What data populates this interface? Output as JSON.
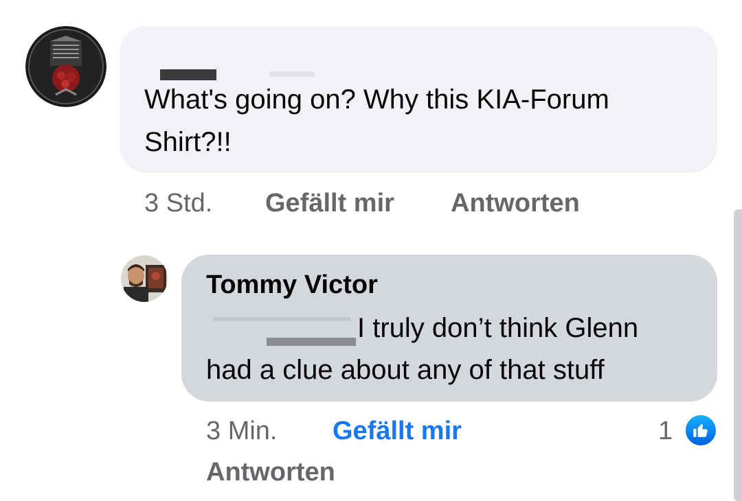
{
  "comments": [
    {
      "avatar_icon": "band-logo-avatar",
      "author": "",
      "text_line1": "What's going on? Why this KIA-Forum",
      "text_line2": "Shirt?!!",
      "meta": {
        "time": "3 Std.",
        "like_label": "Gefällt mir",
        "reply_label": "Antworten"
      }
    },
    {
      "avatar_icon": "person-avatar",
      "author": "Tommy Victor",
      "text_line1": "I truly don’t think Glenn",
      "text_line2": "had a clue about any of that stuff",
      "meta": {
        "time": "3 Min.",
        "like_label": "Gefällt mir",
        "reply_label": "Antworten"
      },
      "reactions": {
        "count": "1",
        "icon": "like-thumb-icon"
      }
    }
  ],
  "colors": {
    "bubble_gray": "#f0f2f5",
    "bubble_reply": "#d4d7dc",
    "meta_gray": "#65676b",
    "link_blue": "#1877f2"
  }
}
